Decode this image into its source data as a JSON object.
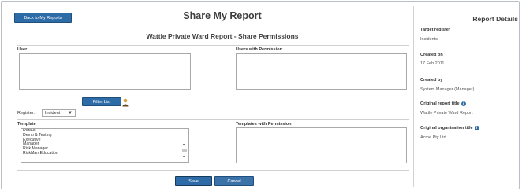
{
  "main": {
    "back_button": "Back to My Reports",
    "title": "Share My Report",
    "subtitle": "Wattle Private Ward Report - Share Permissions",
    "user_label": "User",
    "users_with_permission_label": "Users with Permission",
    "filter_button": "Filter List",
    "register_label": "Register:",
    "register_value": "Incident",
    "template_label": "Template",
    "templates_with_permission_label": "Templates with Permission",
    "templates": [
      "Default",
      "Demo & Testing",
      "Executive",
      "Manager",
      "Risk Manager",
      "RiskMan Education"
    ],
    "save_button": "Save",
    "cancel_button": "Cancel"
  },
  "sidebar": {
    "title": "Report Details",
    "target_register_label": "Target register",
    "target_register_value": "Incidents",
    "created_on_label": "Created on",
    "created_on_value": "17 Feb 2011",
    "created_by_label": "Created by",
    "created_by_value": "System Manager (Manager)",
    "original_title_label": "Original report title",
    "original_title_value": "Wattle Private Ward Report",
    "original_org_label": "Original organisation title",
    "original_org_value": "Acme Pty Ltd"
  },
  "colors": {
    "button_blue": "#2d6ca6",
    "info_icon": "#2d6ca6",
    "border": "#a9a9a9"
  },
  "icons": [
    "user-icon",
    "info-icon",
    "chevron-down-icon",
    "scroll-up-icon",
    "scroll-down-icon"
  ]
}
